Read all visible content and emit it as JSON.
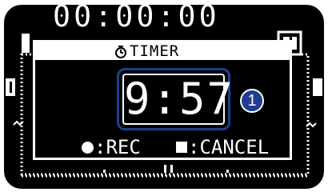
{
  "background": {
    "counter_text": "00:00:00"
  },
  "dialog": {
    "title": "TIMER",
    "title_icon": "timer-icon",
    "time_value": "9:57",
    "callout_number": "1",
    "rec_label": ":REC",
    "cancel_label": ":CANCEL"
  },
  "colors": {
    "screen": "#000000",
    "foreground": "#ffffff",
    "highlight": "#1e3f8f"
  }
}
